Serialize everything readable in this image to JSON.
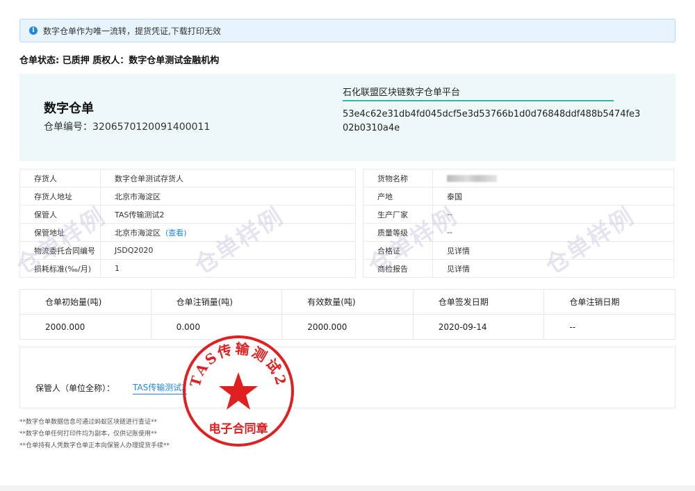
{
  "notice": {
    "text": "数字仓单作为唯一流转，提货凭证,下载打印无效",
    "icon": "info-icon"
  },
  "status": {
    "text": "仓单状态: 已质押 质权人：数字仓单测试金融机构"
  },
  "hero": {
    "title": "数字仓单",
    "receipt_no": "仓单编号：3206570120091400011",
    "platform": "石化联盟区块链数字仓单平台",
    "hash": "53e4c62e31db4fd045dcf5e3d53766b1d0d76848ddf488b5474fe302b0310a4e"
  },
  "left_info": [
    {
      "key": "存货人",
      "value": "数字仓单测试存货人"
    },
    {
      "key": "存货人地址",
      "value": "北京市海淀区"
    },
    {
      "key": "保管人",
      "value": "TAS传输测试2"
    },
    {
      "key": "保管地址",
      "value": "北京市海淀区",
      "link": "(查看)"
    },
    {
      "key": "物流委托合同编号",
      "value": "JSDQ2020"
    },
    {
      "key": "损耗标准(‰/月)",
      "value": "1"
    }
  ],
  "right_info": [
    {
      "key": "货物名称",
      "value": ""
    },
    {
      "key": "产地",
      "value": "泰国"
    },
    {
      "key": "生产厂家",
      "value": "--"
    },
    {
      "key": "质量等级",
      "value": "--"
    },
    {
      "key": "合格证",
      "value": "见详情"
    },
    {
      "key": "商检报告",
      "value": "见详情"
    }
  ],
  "watermark": "仓单样例",
  "quantity": {
    "headers": [
      "仓单初始量(吨)",
      "仓单注销量(吨)",
      "有效数量(吨)",
      "仓单签发日期",
      "仓单注销日期"
    ],
    "values": [
      "2000.000",
      "0.000",
      "2000.000",
      "2020-09-14",
      "--"
    ]
  },
  "keeper": {
    "label": "保管人（单位全称）：",
    "value": "TAS传输测试2"
  },
  "seal": {
    "top_text": "TAS传输测试2",
    "bottom_text": "电子合同章",
    "color": "#e02020"
  },
  "notes": [
    "**数字仓单数据信息可通过蚂蚁区块链进行查证**",
    "**数字仓单任何打印件均为副本，仅供记账使用**",
    "**仓单持有人凭数字仓单正本向保管人办理提货手续**"
  ]
}
